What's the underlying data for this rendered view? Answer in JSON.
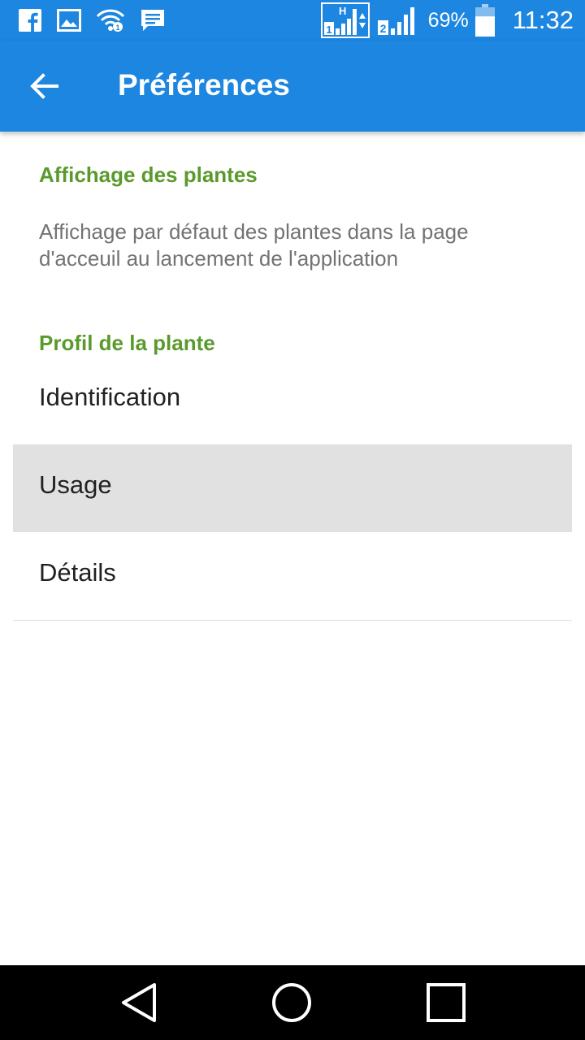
{
  "status_bar": {
    "left_icons": [
      "facebook-icon",
      "image-icon",
      "wifi-icon",
      "message-icon"
    ],
    "sim1_network": "H",
    "sim1_number": "1",
    "sim2_number": "2",
    "battery_percent": "69%",
    "battery_level": 0.69,
    "time": "11:32"
  },
  "app_bar": {
    "back_icon": "arrow-back-icon",
    "title": "Préférences",
    "background_color": "#1c86e0"
  },
  "sections": {
    "display": {
      "title": "Affichage des plantes",
      "summary": "Affichage par défaut des plantes dans la page d'acceuil au lancement de l'application"
    },
    "profile": {
      "title": "Profil de la plante",
      "items": [
        {
          "label": "Identification",
          "selected": false
        },
        {
          "label": "Usage",
          "selected": true
        },
        {
          "label": "Détails",
          "selected": false
        }
      ]
    }
  },
  "colors": {
    "accent": "#5a9a2c",
    "selected_row": "#e1e1e1"
  },
  "nav_bar": {
    "buttons": [
      "back-triangle-icon",
      "home-circle-icon",
      "recents-square-icon"
    ]
  }
}
